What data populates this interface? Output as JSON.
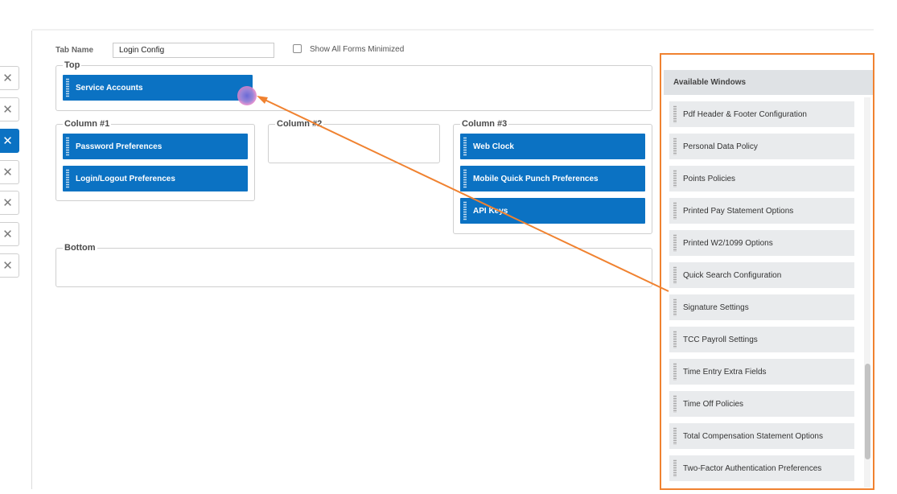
{
  "header": {
    "tab_name_label": "Tab Name",
    "tab_name_value": "Login Config",
    "show_minimized_label": "Show All Forms Minimized",
    "show_minimized_checked": false
  },
  "left_strip": {
    "buttons": [
      {
        "icon": "close-icon",
        "glyph": "✕",
        "active": false
      },
      {
        "icon": "close-icon",
        "glyph": "✕",
        "active": false
      },
      {
        "icon": "close-icon",
        "glyph": "✕",
        "active": true
      },
      {
        "icon": "close-icon",
        "glyph": "✕",
        "active": false
      },
      {
        "icon": "close-icon",
        "glyph": "✕",
        "active": false
      },
      {
        "icon": "close-icon",
        "glyph": "✕",
        "active": false
      },
      {
        "icon": "close-icon",
        "glyph": "✕",
        "active": false
      }
    ]
  },
  "layout": {
    "top": {
      "title": "Top",
      "cards": [
        "Service Accounts"
      ]
    },
    "column1": {
      "title": "Column #1",
      "cards": [
        "Password Preferences",
        "Login/Logout Preferences"
      ]
    },
    "column2": {
      "title": "Column #2",
      "cards": []
    },
    "column3": {
      "title": "Column #3",
      "cards": [
        "Web Clock",
        "Mobile Quick Punch Preferences",
        "API Keys"
      ]
    },
    "bottom": {
      "title": "Bottom",
      "cards": []
    }
  },
  "available_windows": {
    "title": "Available Windows",
    "items": [
      "Pdf Header & Footer Configuration",
      "Personal Data Policy",
      "Points Policies",
      "Printed Pay Statement Options",
      "Printed W2/1099 Options",
      "Quick Search Configuration",
      "Signature Settings",
      "TCC Payroll Settings",
      "Time Entry Extra Fields",
      "Time Off Policies",
      "Total Compensation Statement Options",
      "Two-Factor Authentication Preferences"
    ]
  },
  "colors": {
    "card_blue": "#0b72c3",
    "annotation_orange": "#f08230",
    "panel_header_gray": "#dfe2e5",
    "item_gray": "#e9ebed"
  }
}
